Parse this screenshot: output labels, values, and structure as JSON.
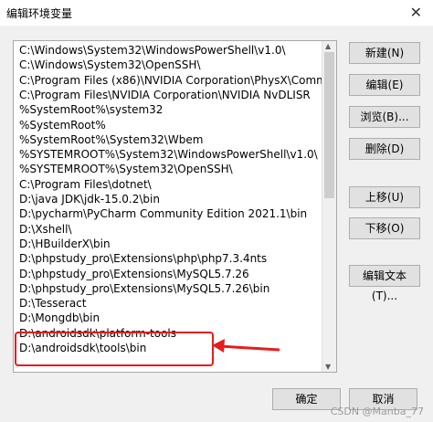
{
  "window": {
    "title": "编辑环境变量",
    "close_glyph": "✕"
  },
  "paths": [
    "C:\\Windows\\System32\\WindowsPowerShell\\v1.0\\",
    "C:\\Windows\\System32\\OpenSSH\\",
    "C:\\Program Files (x86)\\NVIDIA Corporation\\PhysX\\Common",
    "C:\\Program Files\\NVIDIA Corporation\\NVIDIA NvDLISR",
    "%SystemRoot%\\system32",
    "%SystemRoot%",
    "%SystemRoot%\\System32\\Wbem",
    "%SYSTEMROOT%\\System32\\WindowsPowerShell\\v1.0\\",
    "%SYSTEMROOT%\\System32\\OpenSSH\\",
    "C:\\Program Files\\dotnet\\",
    "D:\\java JDK\\jdk-15.0.2\\bin",
    "D:\\pycharm\\PyCharm Community Edition 2021.1\\bin",
    "D:\\Xshell\\",
    "D:\\HBuilderX\\bin",
    "D:\\phpstudy_pro\\Extensions\\php\\php7.3.4nts",
    "D:\\phpstudy_pro\\Extensions\\MySQL5.7.26",
    "D:\\phpstudy_pro\\Extensions\\MySQL5.7.26\\bin",
    "D:\\Tesseract",
    "D:\\Mongdb\\bin",
    "D:\\androidsdk\\platform-tools",
    "D:\\androidsdk\\tools\\bin"
  ],
  "buttons": {
    "new": "新建(N)",
    "edit": "编辑(E)",
    "browse": "浏览(B)...",
    "delete": "删除(D)",
    "move_up": "上移(U)",
    "move_down": "下移(O)",
    "edit_text": "编辑文本(T)...",
    "ok": "确定",
    "cancel": "取消"
  },
  "annotation": {
    "color": "#e41d1d"
  },
  "watermark": "CSDN @Manba_77"
}
